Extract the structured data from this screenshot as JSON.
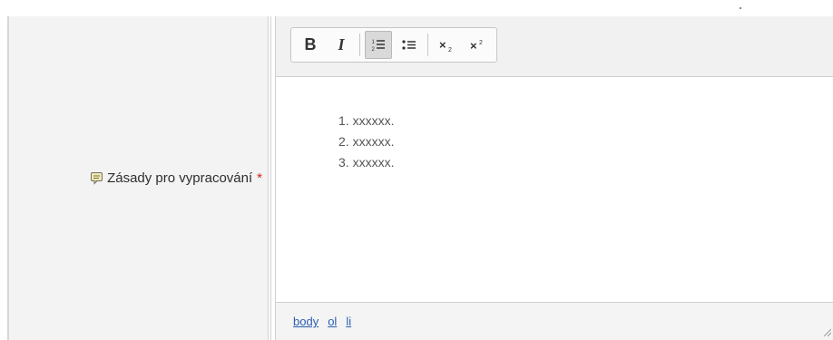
{
  "field": {
    "label": "Zásady pro vypracování",
    "required_mark": "*",
    "required_color": "#d81e1e"
  },
  "toolbar": {
    "buttons": [
      {
        "label": "B",
        "icon": "bold-icon"
      },
      {
        "label": "I",
        "icon": "italic-icon"
      },
      {
        "label": "",
        "icon": "ordered-list-icon",
        "active": true
      },
      {
        "label": "",
        "icon": "unordered-list-icon"
      },
      {
        "label": "",
        "icon": "subscript-icon"
      },
      {
        "label": "",
        "icon": "superscript-icon"
      }
    ]
  },
  "editor": {
    "items": [
      "1. xxxxxx.",
      "2. xxxxxx.",
      "3. xxxxxx."
    ]
  },
  "statusbar": {
    "path": [
      "body",
      "ol",
      "li"
    ],
    "link_color": "#2a5db0"
  }
}
